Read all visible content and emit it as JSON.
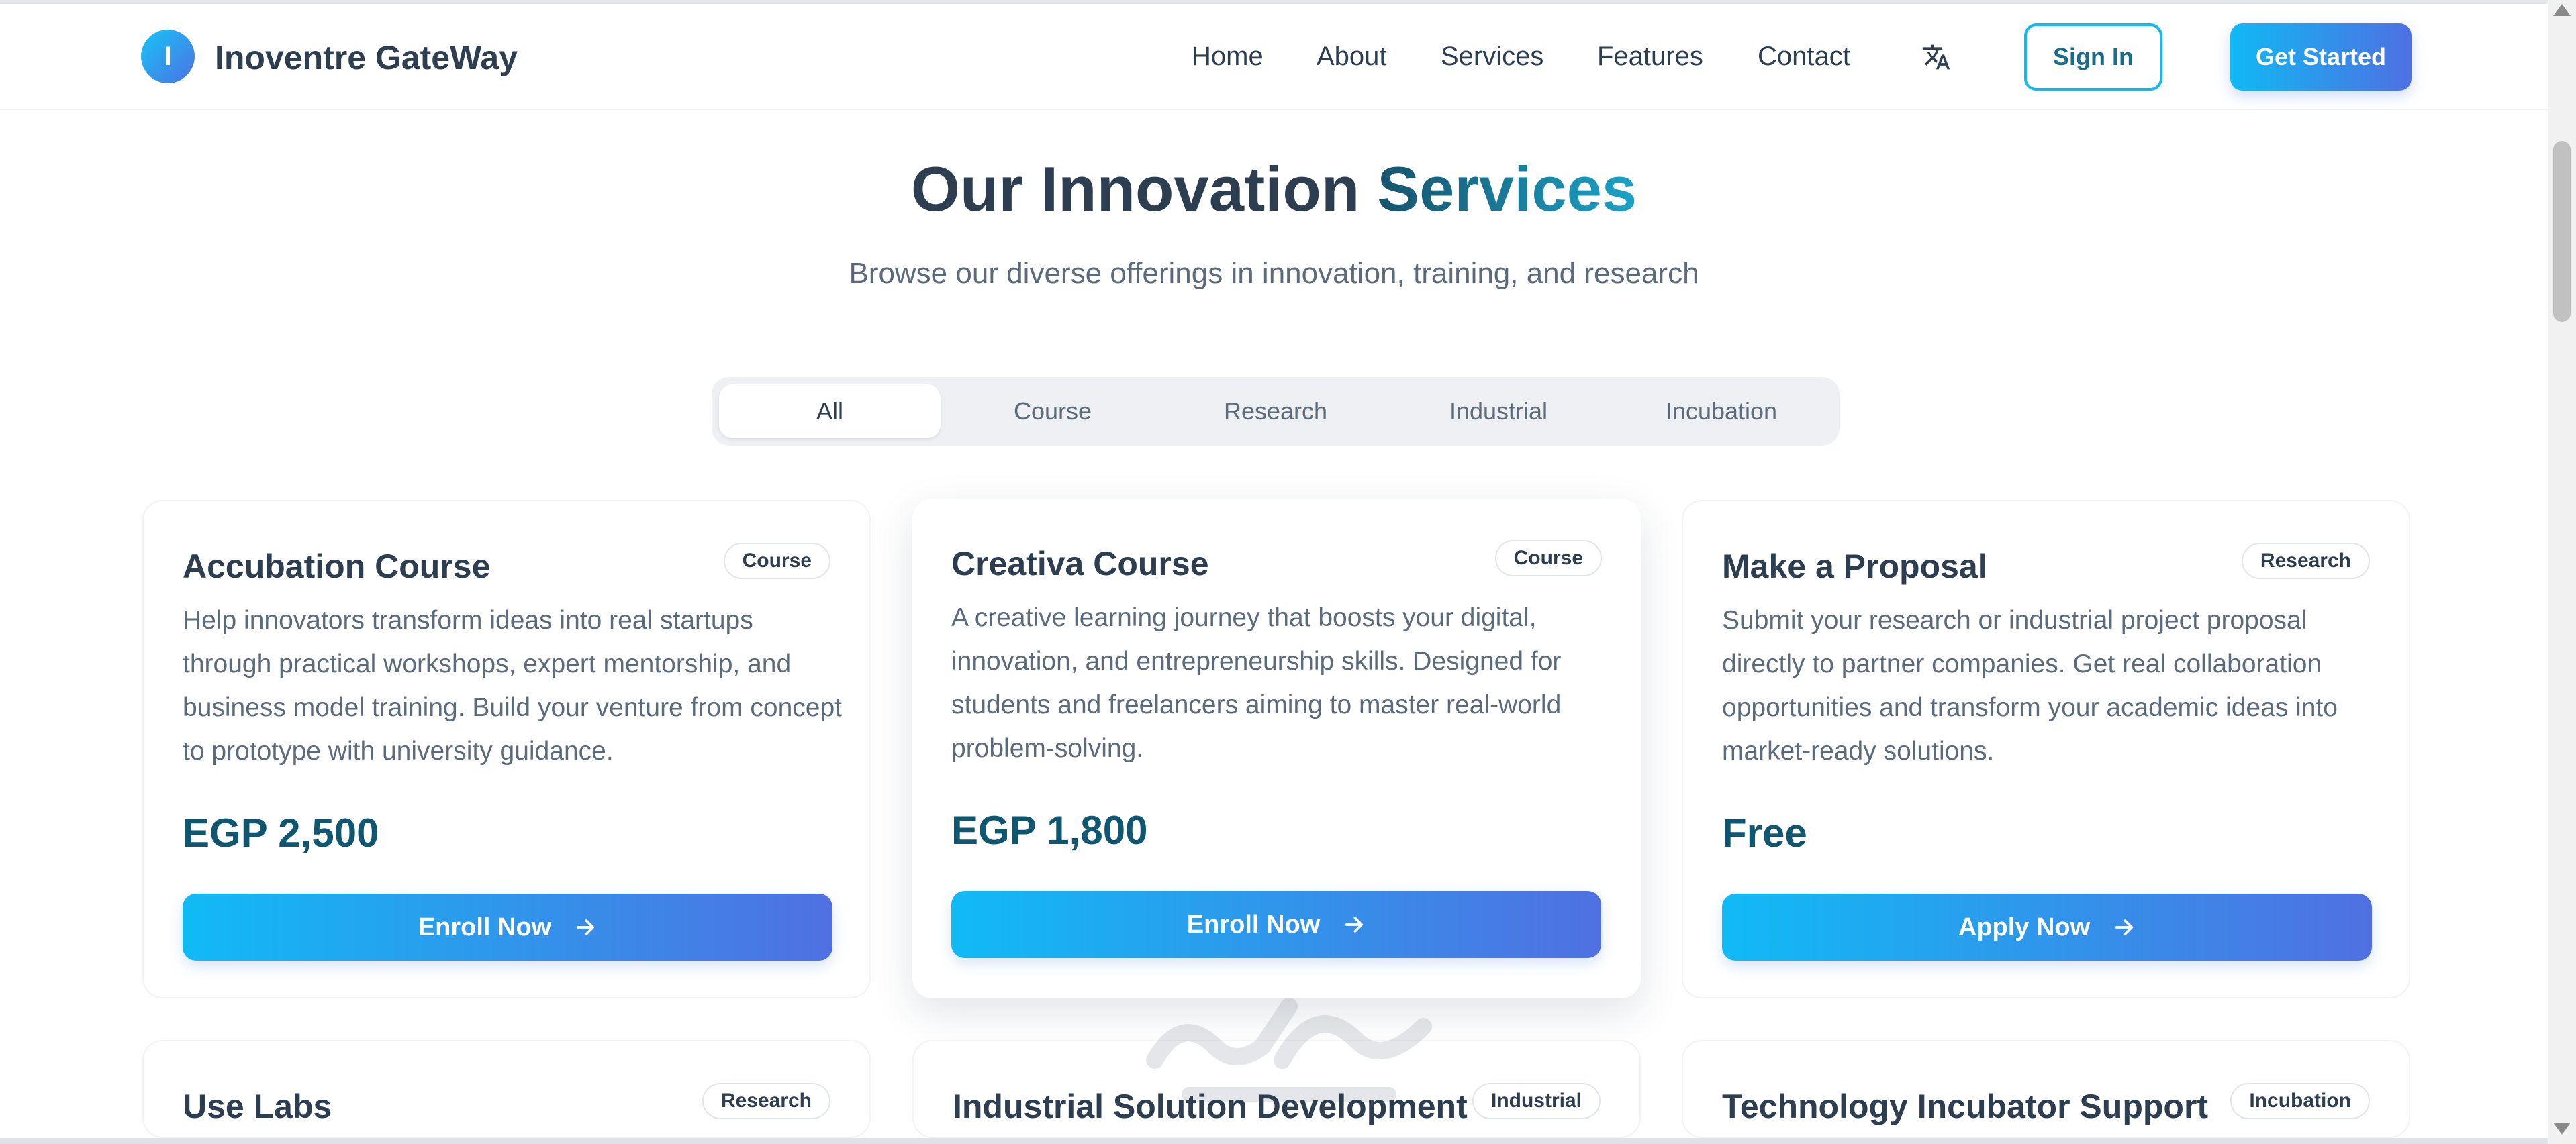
{
  "brand": {
    "logo_letter": "I",
    "name": "Inoventre GateWay"
  },
  "nav": {
    "links": [
      "Home",
      "About",
      "Services",
      "Features",
      "Contact"
    ],
    "sign_in": "Sign In",
    "get_started": "Get Started"
  },
  "hero": {
    "title_main": "Our Innovation ",
    "title_accent": "Services",
    "subtitle": "Browse our diverse offerings in innovation, training, and research"
  },
  "filters": {
    "tabs": [
      "All",
      "Course",
      "Research",
      "Industrial",
      "Incubation"
    ],
    "active": "All"
  },
  "cards": [
    {
      "title": "Accubation Course",
      "badge": "Course",
      "description": "Help innovators transform ideas into real startups through practical workshops, expert mentorship, and business model training. Build your venture from concept to prototype with university guidance.",
      "price": "EGP 2,500",
      "button": "Enroll Now"
    },
    {
      "title": "Creativa Course",
      "badge": "Course",
      "description": "A creative learning journey that boosts your digital, innovation, and entrepreneurship skills. Designed for students and freelancers aiming to master real-world problem-solving.",
      "price": "EGP 1,800",
      "button": "Enroll Now"
    },
    {
      "title": "Make a Proposal",
      "badge": "Research",
      "description": "Submit your research or industrial project proposal directly to partner companies. Get real collaboration opportunities and transform your academic ideas into market-ready solutions.",
      "price": "Free",
      "button": "Apply Now"
    },
    {
      "title": "Use Labs",
      "badge": "Research"
    },
    {
      "title": "Industrial Solution Development",
      "badge": "Industrial"
    },
    {
      "title": "Technology Incubator Support",
      "badge": "Incubation"
    }
  ],
  "colors": {
    "accent_start": "#10bbf4",
    "accent_end": "#5070e2",
    "price": "#0f5670",
    "text": "#2c3e50"
  },
  "icons": [
    "translate-icon",
    "arrow-right-icon"
  ]
}
